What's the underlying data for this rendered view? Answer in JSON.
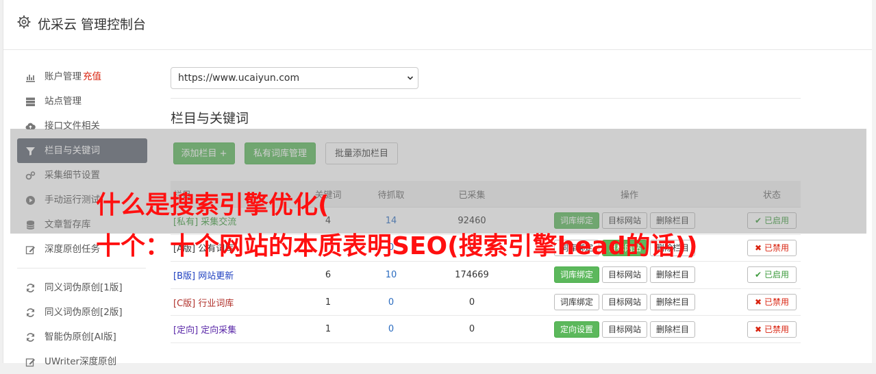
{
  "header": {
    "title": "优采云 管理控制台"
  },
  "sidebar": {
    "items": [
      {
        "label": "账户管理",
        "extra": "充值",
        "icon": "bar-chart-icon"
      },
      {
        "label": "站点管理",
        "icon": "server-icon"
      },
      {
        "label": "接口文件相关",
        "icon": "cloud-upload-icon"
      },
      {
        "label": "栏目与关键词",
        "icon": "filter-icon",
        "active": true
      },
      {
        "label": "采集细节设置",
        "icon": "gears-icon"
      },
      {
        "label": "手动运行测试",
        "icon": "play-circle-icon"
      },
      {
        "label": "文章暂存库",
        "icon": "database-icon"
      },
      {
        "label": "深度原创任务",
        "icon": "edit-icon"
      }
    ],
    "items2": [
      {
        "label": "同义词伪原创[1版]",
        "icon": "refresh-icon"
      },
      {
        "label": "同义词伪原创[2版]",
        "icon": "refresh-icon"
      },
      {
        "label": "智能伪原创[AI版]",
        "icon": "refresh-icon"
      },
      {
        "label": "UWriter深度原创",
        "icon": "edit-icon"
      }
    ]
  },
  "site_select": {
    "value": "https://www.ucaiyun.com"
  },
  "section": {
    "title": "栏目与关键词"
  },
  "toolbar": {
    "add_label": "添加栏目 +",
    "private_lib_label": "私有词库管理",
    "batch_add_label": "批量添加栏目"
  },
  "table": {
    "headers": {
      "name": "栏目",
      "n1": "关键词",
      "n2": "待抓取",
      "n3": "已采集",
      "op": "操作",
      "status": "状态"
    },
    "rows": [
      {
        "tag": "[私有]",
        "name": "采集交流",
        "n1": "4",
        "n2": "14",
        "n3": "92460",
        "op1": "词库绑定",
        "op2": "目标网站",
        "op3": "删除栏目",
        "status": "已启用"
      },
      {
        "tag": "[A版]",
        "name": "公有词库",
        "n1": "",
        "n2": "0",
        "n3": "0",
        "op1": "词库绑定",
        "op2": "目标网站",
        "op3": "删除栏目",
        "status": "已禁用"
      },
      {
        "tag": "[B版]",
        "name": "网站更新",
        "n1": "6",
        "n2": "10",
        "n3": "174669",
        "op1": "词库绑定",
        "op2": "目标网站",
        "op3": "删除栏目",
        "status": "已启用"
      },
      {
        "tag": "[C版]",
        "name": "行业词库",
        "n1": "1",
        "n2": "0",
        "n3": "0",
        "op1": "词库绑定",
        "op2": "目标网站",
        "op3": "删除栏目",
        "status": "已禁用"
      },
      {
        "tag": "[定向]",
        "name": "定向采集",
        "n1": "1",
        "n2": "0",
        "n3": "0",
        "op1": "定向设置",
        "op2": "目标网站",
        "op3": "删除栏目",
        "status": "已禁用"
      }
    ]
  },
  "watermark": {
    "line1": "什么是搜索引擎优化(",
    "line2": "十个：十个网站的本质表明SEO(搜索引擎head的话))"
  },
  "colors": {
    "accent_green": "#5cb85c",
    "active_nav": "#5d6470",
    "watermark_red": "#ff1010",
    "recharge_red": "#d9230f"
  }
}
